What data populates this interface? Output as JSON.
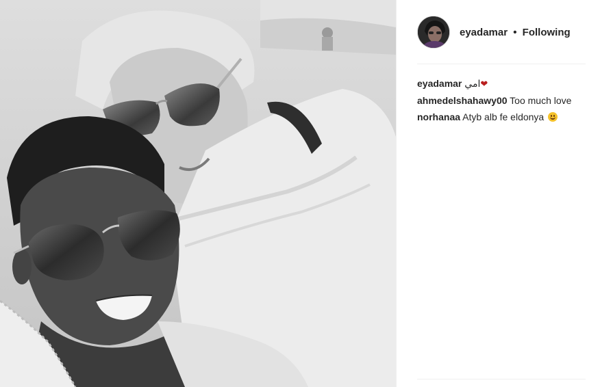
{
  "post": {
    "photo": {
      "description_icon": "selfie-photo"
    },
    "author": {
      "username": "eyadamar",
      "separator": "•",
      "follow_status": "Following",
      "avatar_icon": "profile-avatar"
    },
    "caption": {
      "username": "eyadamar",
      "text": "امي",
      "emoji_icon": "red-heart-icon",
      "emoji_glyph": "❤"
    },
    "comments": [
      {
        "username": "ahmedelshahawy00",
        "text": "Too much love"
      },
      {
        "username": "norhanaa",
        "text": "Atyb alb fe eldonya",
        "emoji_icon": "smiling-face-icon"
      }
    ]
  },
  "colors": {
    "text": "#262626",
    "divider": "#efefef",
    "heart": "#b91e1e",
    "emoji": "#f5c22b"
  }
}
